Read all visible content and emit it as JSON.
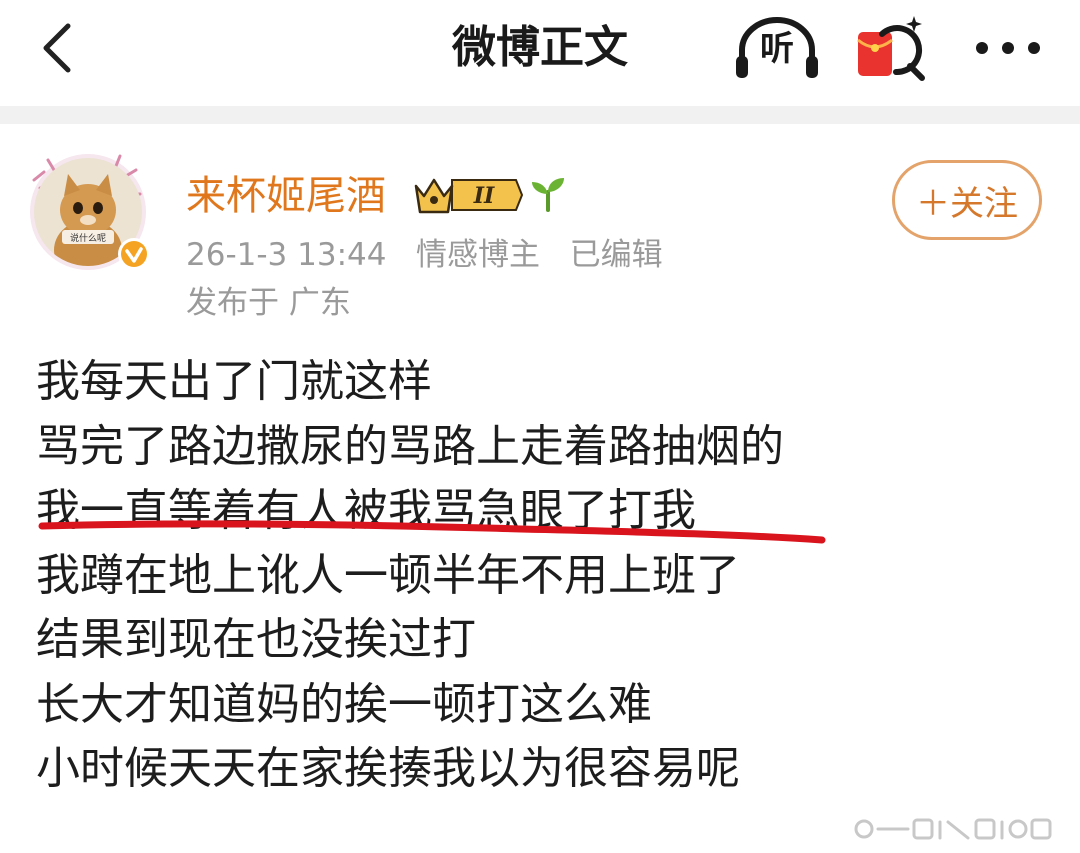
{
  "header": {
    "title": "微博正文",
    "listen_label": "听",
    "back_icon": "back-arrow-icon",
    "listen_icon": "headphones-icon",
    "redpack_icon": "red-envelope-search-icon",
    "more_icon": "more-dots-icon"
  },
  "post": {
    "author": {
      "name": "来杯姬尾酒",
      "avatar_caption": "说什么呢",
      "verified_icon": "verified-badge-icon",
      "vip_level": "II"
    },
    "time": "26-1-3 13:44",
    "role": "情感博主",
    "edited": "已编辑",
    "location": "发布于 广东",
    "follow_label": "＋关注",
    "lines": [
      "我每天出了门就这样",
      "骂完了路边撒尿的骂路上走着路抽烟的",
      "我一直等着有人被我骂急眼了打我",
      "我蹲在地上讹人一顿半年不用上班了",
      "结果到现在也没挨过打",
      "长大才知道妈的挨一顿打这么难",
      "小时候天天在家挨揍我以为很容易呢"
    ],
    "highlighted_line_index": 2
  },
  "colors": {
    "username": "#e0771c",
    "meta": "#9a9a9a",
    "follow_border": "#e3a36a",
    "follow_text": "#d6782c",
    "underline": "#d9141d",
    "separator": "#f1f1f1"
  }
}
